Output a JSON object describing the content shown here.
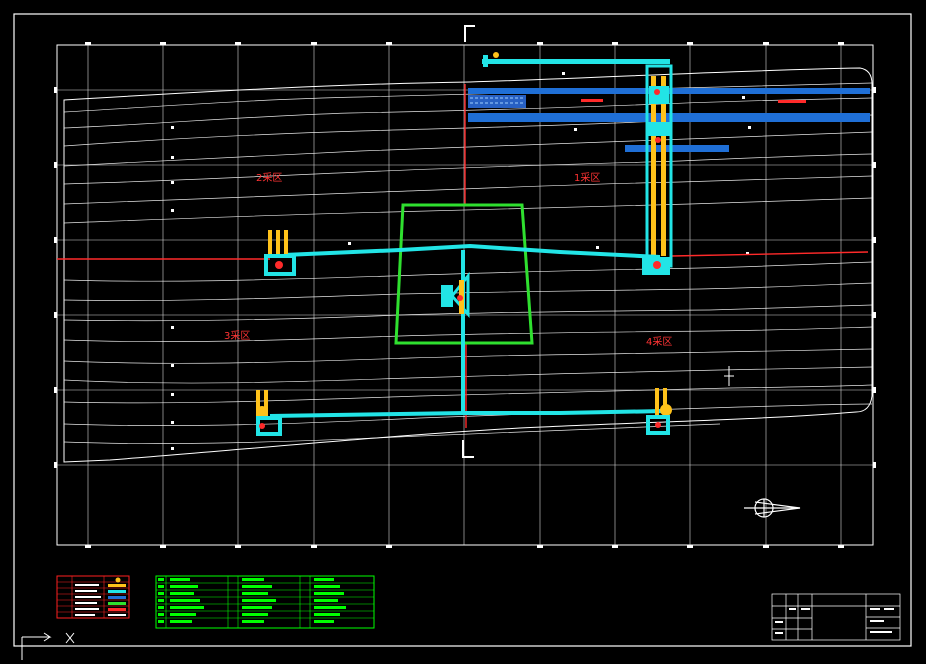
{
  "drawing": {
    "background": "#000000",
    "frame_color": "#ffffff",
    "zones": [
      {
        "id": "zone-1",
        "label": "1采区"
      },
      {
        "id": "zone-2",
        "label": "2采区"
      },
      {
        "id": "zone-3",
        "label": "3采区"
      },
      {
        "id": "zone-4",
        "label": "4采区"
      }
    ],
    "colors": {
      "roadway_main": "#22e4e6",
      "roadway_blue": "#1f6fd6",
      "shaft_outline": "#2fe02f",
      "red_line": "#ff2a2a",
      "yellow": "#ffc21a",
      "zone_label": "#ff3333",
      "legend_green": "#00ff00",
      "legend_red": "#ff2020"
    },
    "icons": [
      "north-arrow-icon",
      "ucs-axis-icon"
    ]
  }
}
